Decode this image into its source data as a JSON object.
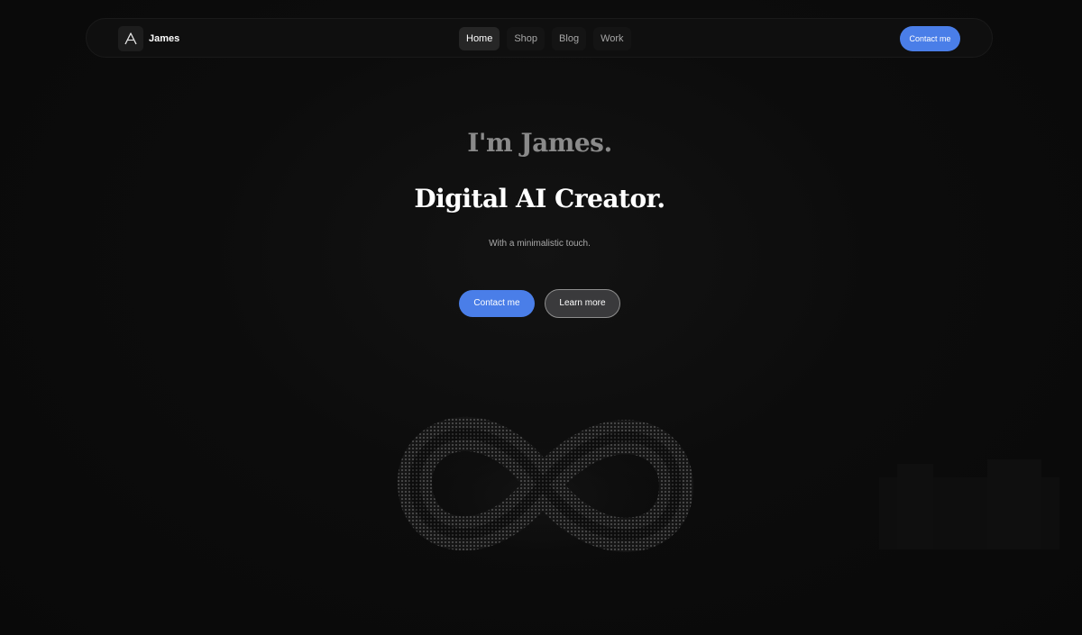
{
  "brand": {
    "name": "James",
    "logo_icon": "a-logo-icon"
  },
  "nav": {
    "items": [
      {
        "label": "Home",
        "active": true
      },
      {
        "label": "Shop",
        "active": false
      },
      {
        "label": "Blog",
        "active": false
      },
      {
        "label": "Work",
        "active": false
      }
    ],
    "cta_label": "Contact me"
  },
  "hero": {
    "greeting": "I'm James.",
    "headline": "Digital AI Creator.",
    "subtitle": "With a minimalistic touch.",
    "primary_button": "Contact me",
    "secondary_button": "Learn more",
    "art_icon": "infinity-icon"
  },
  "colors": {
    "accent": "#4a7ee8",
    "background": "#0b0b0b",
    "muted_text": "#8a8a8a"
  }
}
